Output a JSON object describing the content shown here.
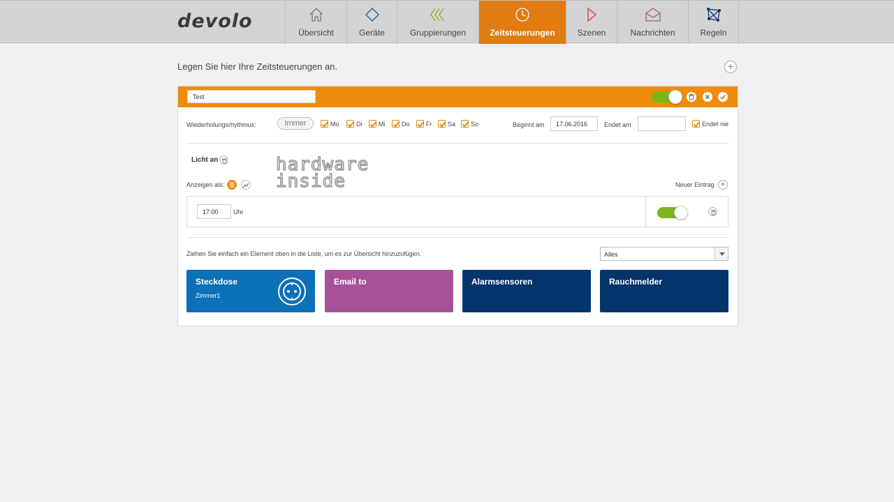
{
  "brand": {
    "logo": "devolo",
    "accent": "#e07c12",
    "toggle_on": "#7bb51c"
  },
  "nav": [
    {
      "label": "Übersicht",
      "icon": "home-icon"
    },
    {
      "label": "Geräte",
      "icon": "diamond-icon"
    },
    {
      "label": "Gruppierungen",
      "icon": "chevrons-icon"
    },
    {
      "label": "Zeitsteuerungen",
      "icon": "clock-icon",
      "active": true
    },
    {
      "label": "Szenen",
      "icon": "play-icon"
    },
    {
      "label": "Nachrichten",
      "icon": "envelope-icon"
    },
    {
      "label": "Regeln",
      "icon": "network-icon"
    }
  ],
  "heading": "Legen Sie hier Ihre Zeitsteuerungen an.",
  "schedule": {
    "name": "Test",
    "enabled": true,
    "repeat_label": "Wiederholungsrhythmus:",
    "repeat_mode": "Immer",
    "days": [
      "Mo",
      "Di",
      "Mi",
      "Do",
      "Fr",
      "Sa",
      "So"
    ],
    "begins_label": "Beginnt am",
    "begins_value": "17.06.2016",
    "ends_label": "Endet am",
    "ends_value": "",
    "never_ends_label": "Endet nie"
  },
  "action": {
    "title": "Licht an",
    "show_as_label": "Anzeigen als:",
    "new_entry_label": "Neuer Eintrag",
    "entry_time": "17:00",
    "entry_unit": "Uhr",
    "entry_enabled": true
  },
  "watermark": {
    "line1": "hardware",
    "line2": "inside"
  },
  "drag_hint": "Ziehen Sie einfach ein Element oben in die Liste, um es zur Übersicht hinzuzufügen.",
  "filter": {
    "selected": "Alles"
  },
  "tiles": [
    {
      "title": "Steckdose",
      "subtitle": "Zimmer1",
      "color": "#0a70b8"
    },
    {
      "title": "Email to",
      "subtitle": "",
      "color": "#a6529a"
    },
    {
      "title": "Alarmsensoren",
      "subtitle": "",
      "color": "#04346a"
    },
    {
      "title": "Rauchmelder",
      "subtitle": "",
      "color": "#04346a"
    }
  ]
}
